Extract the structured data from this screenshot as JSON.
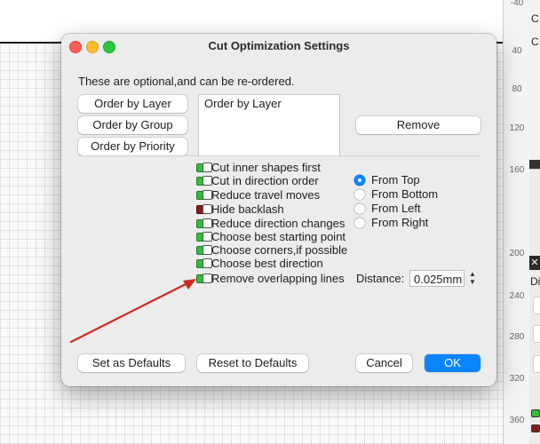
{
  "background": {
    "ruler_ticks": [
      "-40",
      "40",
      "80",
      "120",
      "160",
      "200",
      "240",
      "280",
      "320",
      "360"
    ],
    "right_panel": {
      "item1": "C",
      "item2": "C",
      "close": "✕",
      "item3": "Di"
    }
  },
  "dialog": {
    "title": "Cut Optimization Settings",
    "intro": "These are optional,and can be re-ordered.",
    "order_buttons": {
      "by_layer": "Order by Layer",
      "by_group": "Order by Group",
      "by_priority": "Order by Priority"
    },
    "order_list": [
      "Order by Layer"
    ],
    "remove_label": "Remove",
    "options": [
      {
        "label": "Cut inner shapes first",
        "on": true
      },
      {
        "label": "Cut in direction order",
        "on": true
      },
      {
        "label": "Reduce travel moves",
        "on": true
      },
      {
        "label": "Hide backlash",
        "on": false
      },
      {
        "label": "Reduce direction changes",
        "on": true
      },
      {
        "label": "Choose best starting point",
        "on": true
      },
      {
        "label": "Choose corners,if possible",
        "on": true
      },
      {
        "label": "Choose best direction",
        "on": true
      },
      {
        "label": "Remove overlapping lines",
        "on": true
      }
    ],
    "direction": {
      "options": [
        "From Top",
        "From Bottom",
        "From Left",
        "From Right"
      ],
      "selected": "From Top"
    },
    "distance": {
      "label": "Distance:",
      "value": "0.025mm"
    },
    "footer": {
      "set_defaults": "Set as Defaults",
      "reset_defaults": "Reset to Defaults",
      "cancel": "Cancel",
      "ok": "OK"
    },
    "colors": {
      "accent": "#0b84ff",
      "led_on": "#2fbf3c",
      "led_off": "#8b1b1b",
      "annotation": "#d1281c"
    }
  }
}
